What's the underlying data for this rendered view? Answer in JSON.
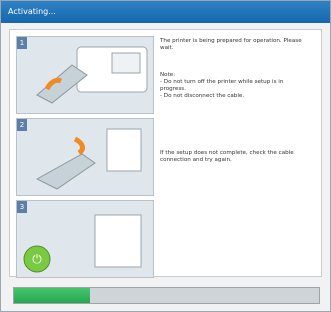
{
  "title": "Activating...",
  "steps": [
    {
      "n": "1",
      "text": "The printer is being prepared for operation. Please wait."
    },
    {
      "n": "2",
      "text": "Note:\n- Do not turn off the printer while setup is in progress.\n- Do not disconnect the cable."
    },
    {
      "n": "3",
      "text": "If the setup does not complete, check the cable connection and try again."
    }
  ],
  "progress": 0.25,
  "colors": {
    "titlebar": "#1667ad",
    "progress": "#2fb45c",
    "badge": "#5b7fa6"
  }
}
